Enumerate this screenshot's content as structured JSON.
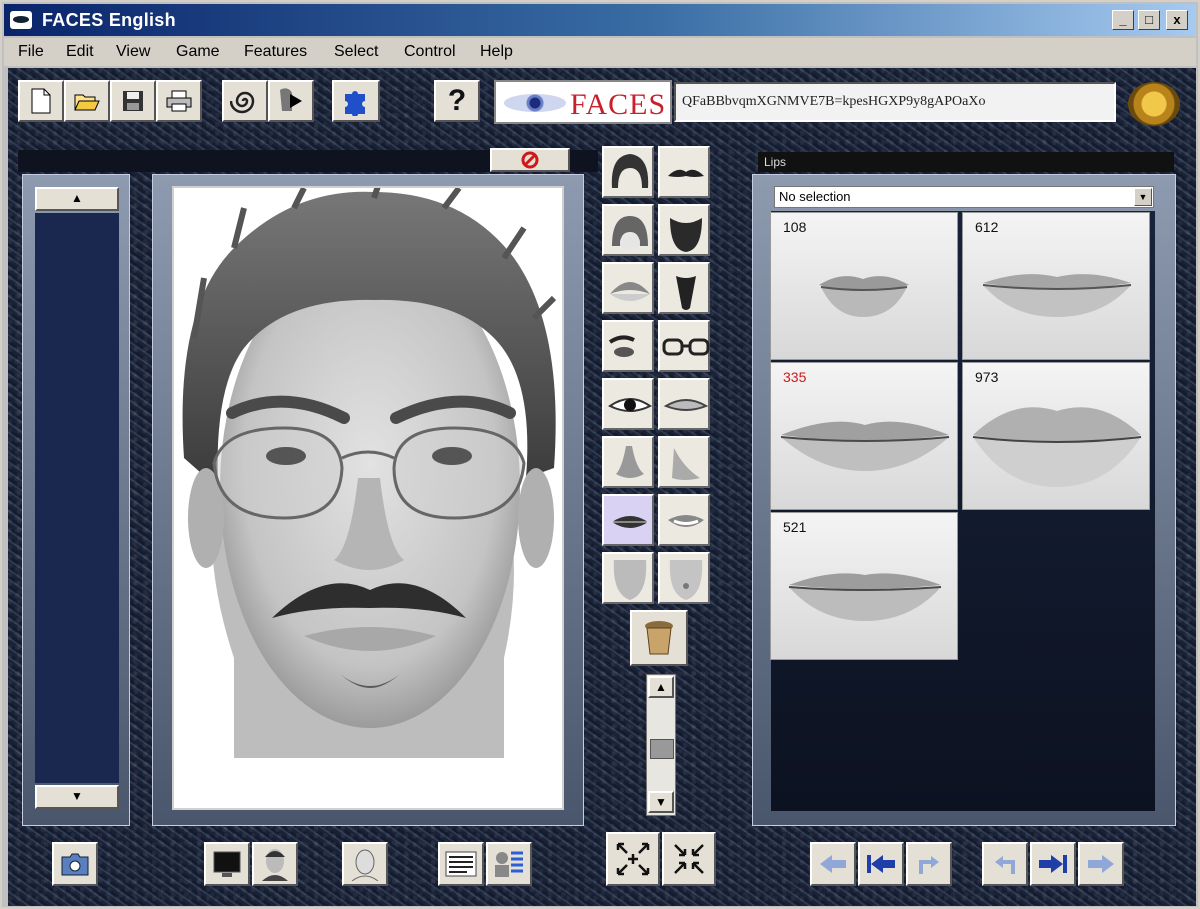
{
  "window": {
    "title": "FACES English",
    "minimize": "_",
    "maximize": "□",
    "close": "x"
  },
  "menu": [
    "File",
    "Edit",
    "View",
    "Game",
    "Features",
    "Select",
    "Control",
    "Help"
  ],
  "toolbar": {
    "buttons": [
      "new-file",
      "open-folder",
      "save-disk",
      "print",
      "spiral",
      "play-profile",
      "puzzle",
      "help"
    ],
    "help_label": "?",
    "logo_text": "FACES",
    "face_code": "QFaBBbvqmXGNMVE7B=kpesHGXP9y8gAPOaXo"
  },
  "composite": {
    "feature_label": "Lips"
  },
  "feature_categories": [
    "hair-top",
    "moustache",
    "hair-back",
    "beard",
    "hairline",
    "goatee",
    "eyebrows",
    "glasses",
    "eyes",
    "eyes-alt",
    "nose",
    "nose-side",
    "lips",
    "mouth-open",
    "chin",
    "chin-dimple"
  ],
  "selected_category": "lips",
  "catalog": {
    "dropdown_value": "No selection",
    "items": [
      {
        "number": "108",
        "highlighted": false
      },
      {
        "number": "612",
        "highlighted": false
      },
      {
        "number": "335",
        "highlighted": true
      },
      {
        "number": "973",
        "highlighted": false
      },
      {
        "number": "521",
        "highlighted": false
      }
    ]
  },
  "colors": {
    "highlight_number": "#cc1a1a",
    "selected_category_bg": "#d9d2f2",
    "titlebar": "#0a246a"
  }
}
